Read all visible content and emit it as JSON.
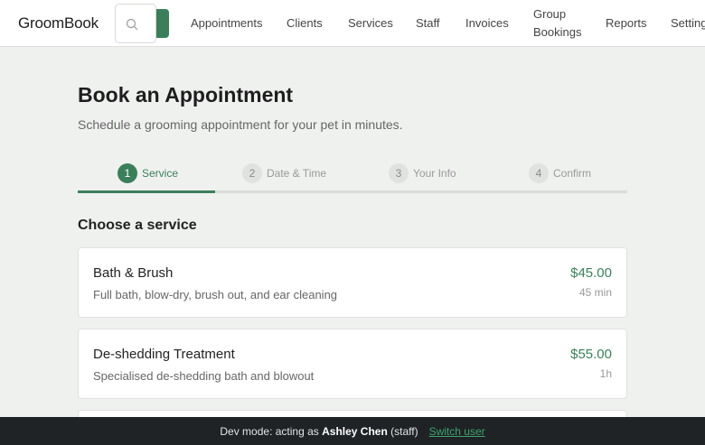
{
  "brand": "GroomBook",
  "nav": {
    "items": [
      {
        "label": "Appointments"
      },
      {
        "label": "Clients"
      },
      {
        "label": "Services"
      },
      {
        "label": "Staff"
      },
      {
        "label": "Invoices"
      },
      {
        "label": "Group Bookings"
      },
      {
        "label": "Reports"
      },
      {
        "label": "Settings"
      }
    ]
  },
  "page": {
    "title": "Book an Appointment",
    "subtitle": "Schedule a grooming appointment for your pet in minutes."
  },
  "steps": [
    {
      "num": "1",
      "label": "Service",
      "active": true
    },
    {
      "num": "2",
      "label": "Date & Time",
      "active": false
    },
    {
      "num": "3",
      "label": "Your Info",
      "active": false
    },
    {
      "num": "4",
      "label": "Confirm",
      "active": false
    }
  ],
  "services": {
    "heading": "Choose a service",
    "items": [
      {
        "name": "Bath & Brush",
        "description": "Full bath, blow-dry, brush out, and ear cleaning",
        "price": "$45.00",
        "duration": "45 min"
      },
      {
        "name": "De-shedding Treatment",
        "description": "Specialised de-shedding bath and blowout",
        "price": "$55.00",
        "duration": "1h"
      }
    ]
  },
  "devbar": {
    "prefix": "Dev mode: acting as",
    "user": "Ashley Chen",
    "role": "(staff)",
    "switch_label": "Switch user"
  },
  "colors": {
    "accent": "#3b7f5a",
    "devbar_bg": "#1f2326"
  }
}
